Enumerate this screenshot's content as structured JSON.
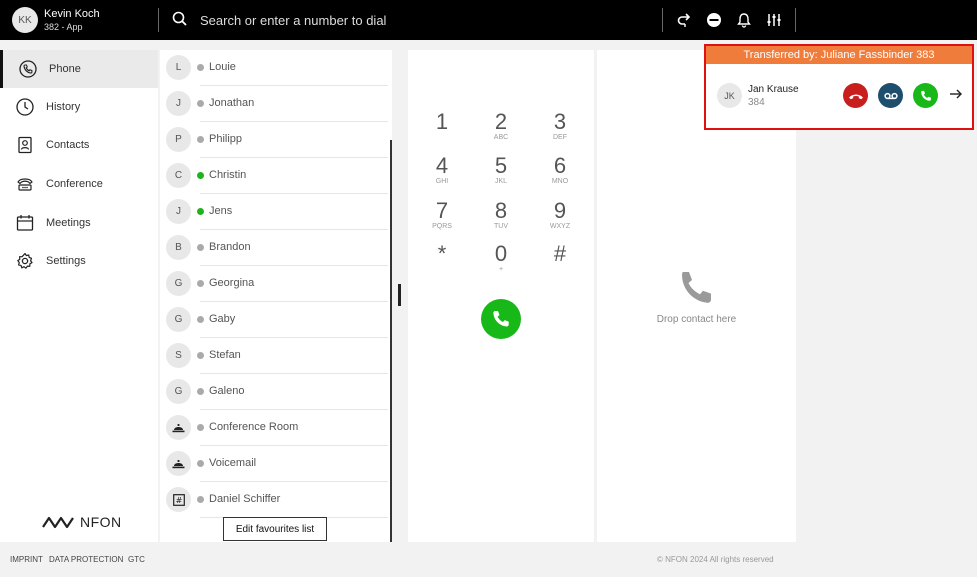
{
  "user": {
    "initials": "KK",
    "name": "Kevin Koch",
    "extension": "382 - App"
  },
  "search": {
    "placeholder": "Search or enter a number to dial"
  },
  "nav": [
    {
      "label": "Phone",
      "icon": "phone-icon",
      "active": true
    },
    {
      "label": "History",
      "icon": "clock-icon"
    },
    {
      "label": "Contacts",
      "icon": "contact-card-icon"
    },
    {
      "label": "Conference",
      "icon": "conference-phone-icon"
    },
    {
      "label": "Meetings",
      "icon": "calendar-icon"
    },
    {
      "label": "Settings",
      "icon": "gear-icon"
    }
  ],
  "brand": {
    "logo_text": "NFON"
  },
  "contacts": [
    {
      "initial": "L",
      "name": "Louie",
      "status": "offline"
    },
    {
      "initial": "J",
      "name": "Jonathan",
      "status": "offline"
    },
    {
      "initial": "P",
      "name": "Philipp",
      "status": "offline"
    },
    {
      "initial": "C",
      "name": "Christin",
      "status": "online"
    },
    {
      "initial": "J",
      "name": "Jens",
      "status": "online"
    },
    {
      "initial": "B",
      "name": "Brandon",
      "status": "offline"
    },
    {
      "initial": "G",
      "name": "Georgina",
      "status": "offline"
    },
    {
      "initial": "G",
      "name": "Gaby",
      "status": "offline"
    },
    {
      "initial": "S",
      "name": "Stefan",
      "status": "offline"
    },
    {
      "initial": "G",
      "name": "Galeno",
      "status": "offline"
    },
    {
      "initial": "",
      "name": "Conference Room",
      "status": "offline",
      "icon": "conference-bell-icon"
    },
    {
      "initial": "",
      "name": "Voicemail",
      "status": "offline",
      "icon": "voicemail-bell-icon"
    },
    {
      "initial": "",
      "name": "Daniel Schiffer",
      "status": "offline",
      "icon": "hash-box-icon"
    }
  ],
  "edit_favourites_label": "Edit favourites list",
  "dialpad": {
    "keys": [
      {
        "digit": "1",
        "letters": ""
      },
      {
        "digit": "2",
        "letters": "ABC"
      },
      {
        "digit": "3",
        "letters": "DEF"
      },
      {
        "digit": "4",
        "letters": "GHI"
      },
      {
        "digit": "5",
        "letters": "JKL"
      },
      {
        "digit": "6",
        "letters": "MNO"
      },
      {
        "digit": "7",
        "letters": "PQRS"
      },
      {
        "digit": "8",
        "letters": "TUV"
      },
      {
        "digit": "9",
        "letters": "WXYZ"
      },
      {
        "digit": "*",
        "letters": ""
      },
      {
        "digit": "0",
        "letters": "+"
      },
      {
        "digit": "#",
        "letters": ""
      }
    ]
  },
  "drop_area": {
    "text": "Drop contact here"
  },
  "transfer": {
    "header": "Transferred by: Juliane Fassbinder 383",
    "caller_initials": "JK",
    "caller_name": "Jan Krause",
    "caller_ext": "384"
  },
  "footer": {
    "links": [
      "IMPRINT",
      "DATA PROTECTION",
      "GTC"
    ],
    "copyright": "© NFON 2024 All rights reserved"
  },
  "colors": {
    "call_green": "#18b818",
    "decline_red": "#c81e1e",
    "voicemail_blue": "#1e4e6e",
    "transfer_orange": "#f07c3c",
    "highlight_red": "#e01010",
    "online_green": "#1db31d"
  }
}
